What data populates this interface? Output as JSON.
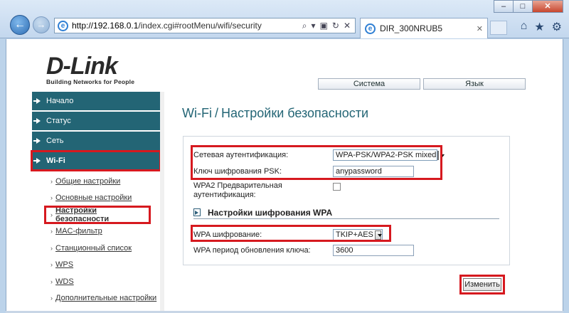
{
  "browser": {
    "url_host": "http://192.168.0.1",
    "url_path": "/index.cgi#rootMenu/wifi/security",
    "tab_title": "DIR_300NRUB5",
    "win_min": "–",
    "win_max": "□",
    "win_close": "✕"
  },
  "logo": {
    "brand": "D-Link",
    "tagline": "Building Networks for People"
  },
  "topnav": [
    "Система",
    "Язык"
  ],
  "sidebar": {
    "items": [
      {
        "label": "Начало"
      },
      {
        "label": "Статус"
      },
      {
        "label": "Сеть"
      },
      {
        "label": "Wi-Fi"
      }
    ],
    "subitems": [
      {
        "label": "Общие настройки"
      },
      {
        "label": "Основные настройки"
      },
      {
        "label": "Настройки безопасности"
      },
      {
        "label": "MAC-фильтр"
      },
      {
        "label": "Станционный список"
      },
      {
        "label": "WPS"
      },
      {
        "label": "WDS"
      },
      {
        "label": "Дополнительные настройки"
      }
    ]
  },
  "main": {
    "title_a": "Wi-Fi",
    "title_sep": "/",
    "title_b": "Настройки безопасности"
  },
  "form": {
    "auth_label": "Сетевая аутентификация:",
    "auth_value": "WPA-PSK/WPA2-PSK mixed",
    "psk_label": "Ключ шифрования PSK:",
    "psk_value": "anypassword",
    "preauth_label_1": "WPA2 Предварительная",
    "preauth_label_2": "аутентификация:",
    "section_title": "Настройки шифрования WPA",
    "cipher_label": "WPA шифрование:",
    "cipher_value": "TKIP+AES",
    "rekey_label": "WPA период обновления ключа:",
    "rekey_value": "3600",
    "apply_label": "Изменить"
  }
}
